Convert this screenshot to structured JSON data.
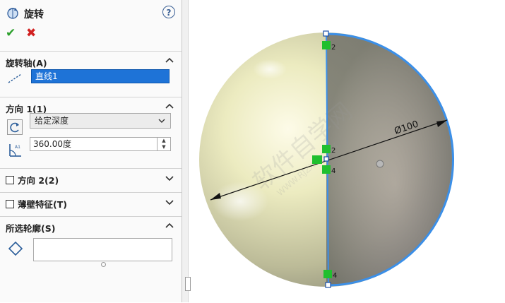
{
  "panel": {
    "title": "旋转",
    "help": "?",
    "ok": "✔",
    "cancel": "✖",
    "sections": {
      "axis": {
        "title": "旋转轴(A)",
        "value": "直线1"
      },
      "direction1": {
        "title": "方向 1(1)",
        "end_condition": "给定深度",
        "angle": "360.00度"
      },
      "direction2": {
        "title": "方向 2(2)"
      },
      "thin": {
        "title": "薄壁特征(T)"
      },
      "profiles": {
        "title": "所选轮廓(S)"
      }
    }
  },
  "viewport": {
    "dimension_label": "Ø100",
    "constraint_labels": [
      "2",
      "2",
      "4",
      "4"
    ],
    "watermark": "软件自学网",
    "watermark_url": "WWW.RJZXW.COM"
  },
  "colors": {
    "accent": "#1e73d7",
    "sketch": "#3b8fe8",
    "relation": "#1fbf2e",
    "ok": "#2ca02c",
    "cancel": "#d12020"
  }
}
